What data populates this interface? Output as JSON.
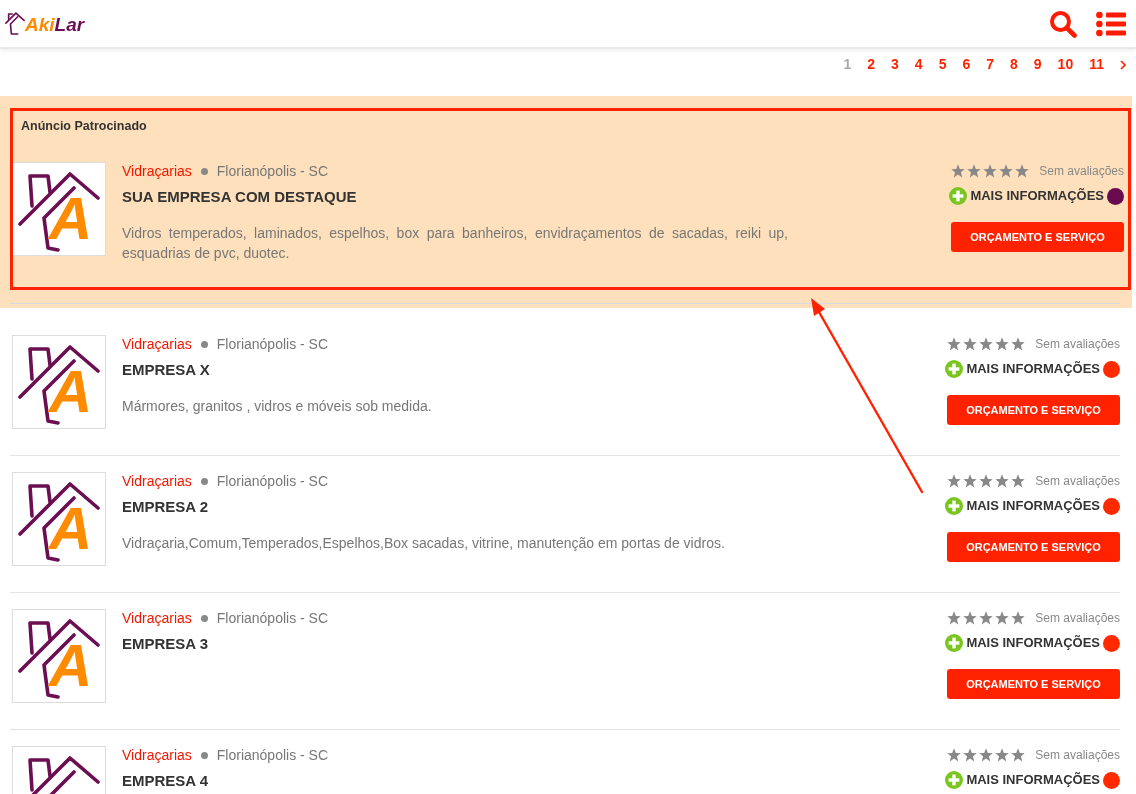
{
  "header": {
    "logo_text": [
      "Aki",
      "Lar"
    ]
  },
  "pagination": {
    "pages": [
      {
        "label": "1",
        "selected": true
      },
      {
        "label": "2",
        "selected": false
      },
      {
        "label": "3",
        "selected": false
      },
      {
        "label": "4",
        "selected": false
      },
      {
        "label": "5",
        "selected": false
      },
      {
        "label": "6",
        "selected": false
      },
      {
        "label": "7",
        "selected": false
      },
      {
        "label": "8",
        "selected": false
      },
      {
        "label": "9",
        "selected": false
      },
      {
        "label": "10",
        "selected": false
      },
      {
        "label": "11",
        "selected": false
      }
    ]
  },
  "sponsored": {
    "label": "Anúncio Patrocinado",
    "listing": {
      "logo_letter": "A",
      "category": "Vidraçarias",
      "location": "Florianópolis - SC",
      "title": "SUA EMPRESA COM DESTAQUE",
      "description": "Vidros temperados, laminados, espelhos, box para banheiros, envidraçamentos de sacadas, reiki up, esquadrias de pvc, duotec.",
      "rating_text": "Sem avaliações",
      "info_link": "MAIS INFORMAÇÕES",
      "color": "#6a0b52",
      "button": "ORÇAMENTO E SERVIÇO"
    }
  },
  "listings": [
    {
      "logo_letter": "A",
      "category": "Vidraçarias",
      "location": "Florianópolis - SC",
      "title": "EMPRESA X",
      "description": "Mármores, granitos , vidros e móveis sob medida.",
      "rating_text": "Sem avaliações",
      "info_link": "MAIS INFORMAÇÕES",
      "color": "#ff2a00",
      "button": "ORÇAMENTO E SERVIÇO"
    },
    {
      "logo_letter": "A",
      "category": "Vidraçarias",
      "location": "Florianópolis - SC",
      "title": "EMPRESA 2",
      "description": "Vidraçaria,Comum,Temperados,Espelhos,Box sacadas, vitrine, manutenção em portas de vidros.",
      "rating_text": "Sem avaliações",
      "info_link": "MAIS INFORMAÇÕES",
      "color": "#ff2a00",
      "button": "ORÇAMENTO E SERVIÇO"
    },
    {
      "logo_letter": "A",
      "category": "Vidraçarias",
      "location": "Florianópolis - SC",
      "title": "EMPRESA 3",
      "rating_text": "Sem avaliações",
      "info_link": "MAIS INFORMAÇÕES",
      "color": "#ff2a00",
      "button": "ORÇAMENTO E SERVIÇO"
    },
    {
      "category": "Vidraçarias",
      "location": "Florianópolis - SC",
      "title": "EMPRESA 4",
      "rating_text": "Sem avaliações",
      "info_link": "MAIS INFORMAÇÕES",
      "color": "#ff2a00"
    }
  ]
}
